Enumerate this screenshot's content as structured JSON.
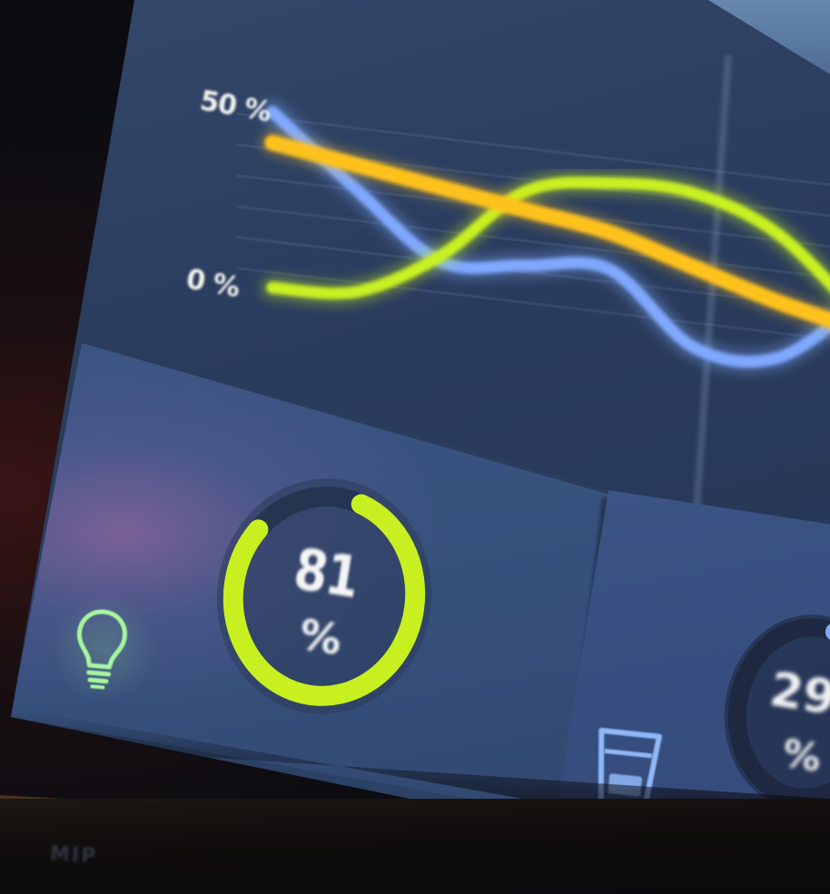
{
  "chart": {
    "tick_top": "50 %",
    "tick_bottom": "0 %"
  },
  "chart_data": {
    "type": "line",
    "title": "",
    "xlabel": "",
    "ylabel": "",
    "ylim": [
      0,
      50
    ],
    "yticks": [
      "0 %",
      "50 %"
    ],
    "grid": true,
    "x": [
      0,
      1,
      2,
      3,
      4,
      5,
      6,
      7
    ],
    "series": [
      {
        "color": "#7fa8ff",
        "values": [
          52,
          30,
          10,
          12,
          14,
          -8,
          -8,
          14
        ]
      },
      {
        "color": "#c8f020",
        "values": [
          -5,
          -3,
          12,
          36,
          42,
          42,
          32,
          8
        ]
      },
      {
        "color": "#ffc21a",
        "values": [
          42,
          38,
          34,
          30,
          26,
          18,
          10,
          4
        ]
      }
    ]
  },
  "gauges": [
    {
      "value": "81",
      "unit": "%",
      "percent": 81,
      "ring_color": "#c8f020",
      "icon": "lightbulb-icon"
    },
    {
      "value": "29",
      "unit": "%",
      "percent": 29,
      "ring_color": "#7fa8ff",
      "icon": "cup-icon"
    }
  ],
  "colors": {
    "panel_blue": "#3b5583",
    "accent_green": "#b8f040",
    "accent_yellow": "#ffc21a",
    "accent_blue": "#7fa8ff"
  }
}
